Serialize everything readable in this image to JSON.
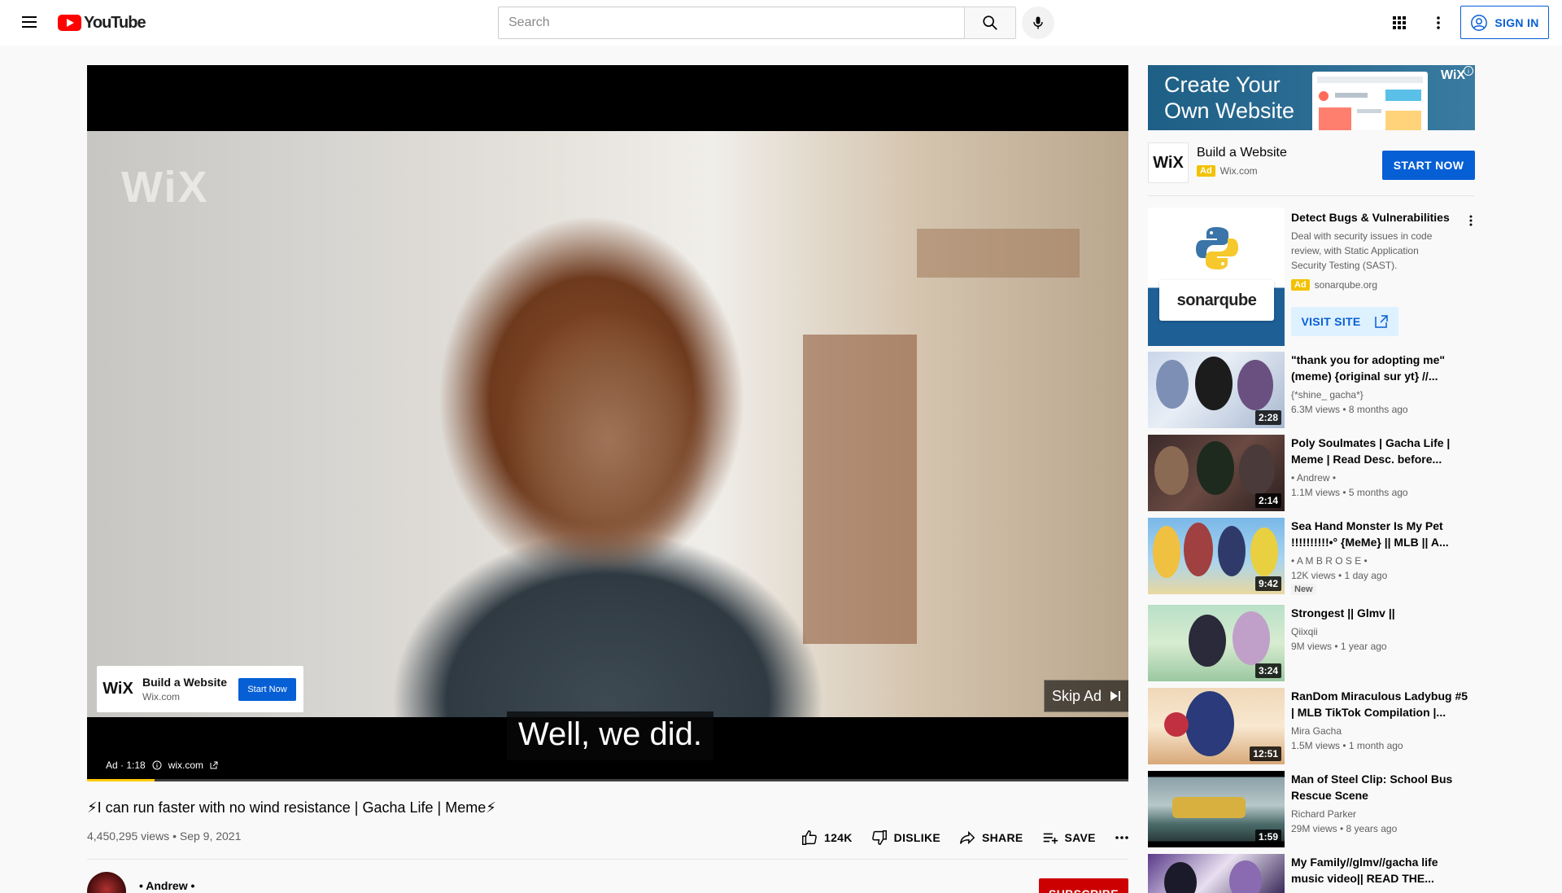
{
  "header": {
    "logo_text": "YouTube",
    "search_placeholder": "Search",
    "signin_label": "SIGN IN"
  },
  "player": {
    "watermark": "WiX",
    "caption": "Well, we did.",
    "overlay_ad": {
      "logo": "WiX",
      "title": "Build a Website",
      "domain": "Wix.com",
      "button": "Start Now"
    },
    "skip_label": "Skip Ad",
    "ad_label": "Ad · 1:18",
    "ad_domain": "wix.com",
    "progress": 0.065,
    "progress_color": "#ffcc00"
  },
  "video": {
    "title": "⚡I can run faster with no wind resistance | Gacha Life | Meme⚡",
    "meta": "4,450,295 views • Sep 9, 2021",
    "actions": {
      "like": "124K",
      "dislike": "DISLIKE",
      "share": "SHARE",
      "save": "SAVE"
    },
    "channel": "• Andrew •",
    "subscribe": "SUBSCRIBE"
  },
  "sidebar": {
    "banner": {
      "line1": "Create Your",
      "line2": "Own Website",
      "brand": "WiX"
    },
    "promo": {
      "logo": "WiX",
      "title": "Build a Website",
      "badge": "Ad",
      "domain": "Wix.com",
      "button": "START NOW"
    },
    "ad_card": {
      "logo_text": "sonarqube",
      "title": "Detect Bugs & Vulnerabilities",
      "description": "Deal with security issues in code review, with Static Application Security Testing (SAST).",
      "badge": "Ad",
      "domain": "sonarqube.org",
      "button": "VISIT SITE"
    },
    "recommendations": [
      {
        "title": "\"thank you for adopting me\" (meme) {original sur yt} //...",
        "channel": "{*shine_ gacha*}",
        "meta": "6.3M views • 8 months ago",
        "duration": "2:28",
        "badge": ""
      },
      {
        "title": "Poly Soulmates | Gacha Life | Meme | Read Desc. before...",
        "channel": "• Andrew •",
        "meta": "1.1M views • 5 months ago",
        "duration": "2:14",
        "badge": ""
      },
      {
        "title": "Sea Hand Monster Is My Pet !!!!!!!!!!•° {MeMe} || MLB  || A...",
        "channel": "• A M B R O S E •",
        "meta": "12K views • 1 day ago",
        "duration": "9:42",
        "badge": "New"
      },
      {
        "title": "Strongest || Glmv ||",
        "channel": "Qiixqii",
        "meta": "9M views • 1 year ago",
        "duration": "3:24",
        "badge": ""
      },
      {
        "title": "RanDom Miraculous Ladybug #5 | MLB TikTok Compilation |...",
        "channel": "Mira Gacha",
        "meta": "1.5M views • 1 month ago",
        "duration": "12:51",
        "badge": ""
      },
      {
        "title": "Man of Steel Clip: School Bus Rescue Scene",
        "channel": "Richard Parker",
        "meta": "29M views • 8 years ago",
        "duration": "1:59",
        "badge": ""
      },
      {
        "title": "My Family//glmv//gacha life music video|| READ THE...",
        "channel": "",
        "meta": "",
        "duration": "",
        "badge": ""
      }
    ]
  }
}
